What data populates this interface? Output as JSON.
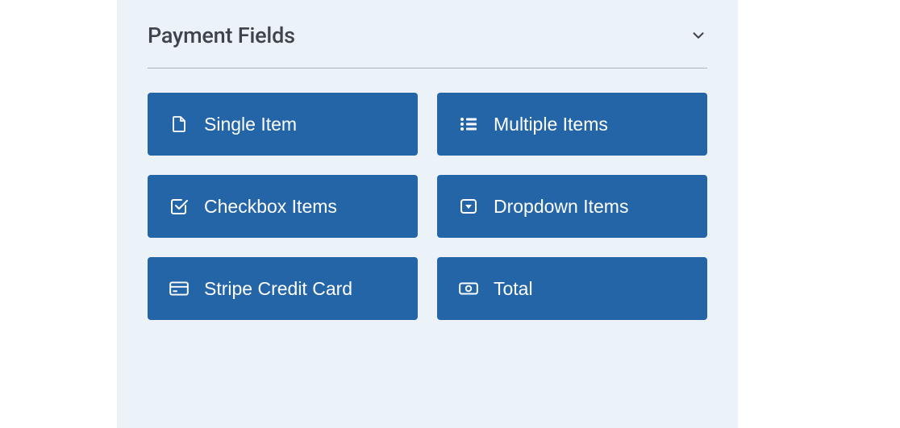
{
  "panel": {
    "title": "Payment Fields",
    "collapsed": false,
    "fields": [
      {
        "icon": "file-icon",
        "label": "Single Item"
      },
      {
        "icon": "list-icon",
        "label": "Multiple Items"
      },
      {
        "icon": "checkbox-icon",
        "label": "Checkbox Items"
      },
      {
        "icon": "dropdown-icon",
        "label": "Dropdown Items"
      },
      {
        "icon": "credit-card-icon",
        "label": "Stripe Credit Card"
      },
      {
        "icon": "money-icon",
        "label": "Total"
      }
    ]
  },
  "colors": {
    "panel_bg": "#ebf3f9",
    "button_bg": "#2465a8",
    "button_text": "#ffffff",
    "title_text": "#3f434a",
    "divider": "#aab3bb"
  }
}
